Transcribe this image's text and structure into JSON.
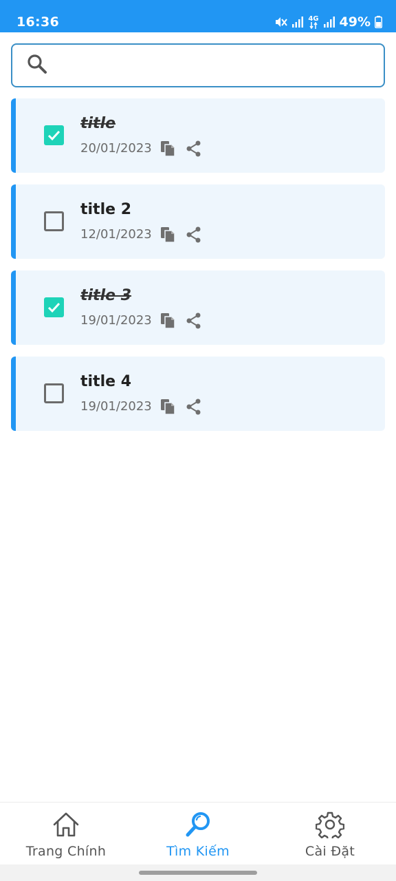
{
  "status_bar": {
    "time": "16:36",
    "network": "4G",
    "battery": "49%"
  },
  "search": {
    "value": "",
    "placeholder": ""
  },
  "tasks": [
    {
      "title": "title",
      "date": "20/01/2023",
      "done": true
    },
    {
      "title": "title 2",
      "date": "12/01/2023",
      "done": false
    },
    {
      "title": "title 3",
      "date": "19/01/2023",
      "done": true
    },
    {
      "title": "title 4",
      "date": "19/01/2023",
      "done": false
    }
  ],
  "nav": {
    "items": [
      {
        "label": "Trang Chính",
        "icon": "home-icon",
        "active": false
      },
      {
        "label": "Tìm Kiếm",
        "icon": "search-icon",
        "active": true
      },
      {
        "label": "Cài Đặt",
        "icon": "gear-icon",
        "active": false
      }
    ]
  },
  "colors": {
    "primary": "#2196f3",
    "checked": "#1ed3b8",
    "card_background": "#eef6fd"
  }
}
